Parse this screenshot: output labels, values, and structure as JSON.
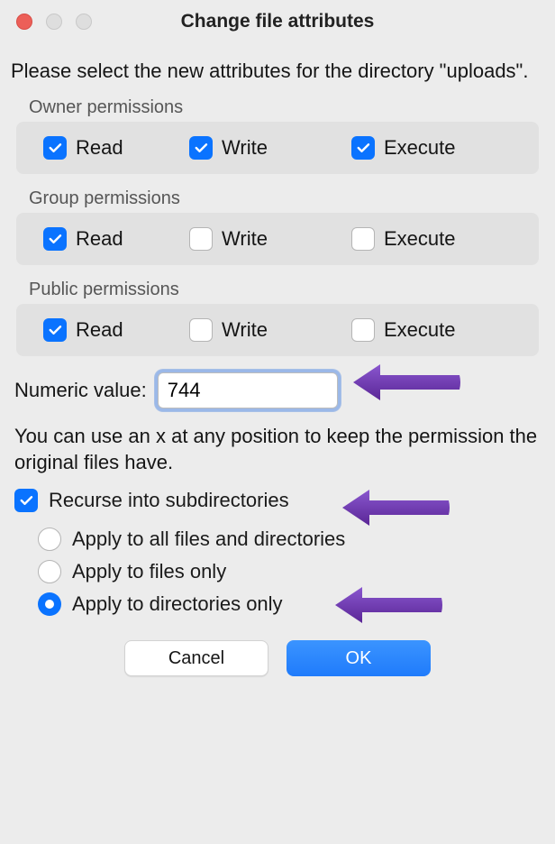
{
  "window": {
    "title": "Change file attributes"
  },
  "intro": "Please select the new attributes for the directory \"uploads\".",
  "permissions": {
    "owner": {
      "label": "Owner permissions",
      "read": {
        "label": "Read",
        "checked": true
      },
      "write": {
        "label": "Write",
        "checked": true
      },
      "execute": {
        "label": "Execute",
        "checked": true
      }
    },
    "group": {
      "label": "Group permissions",
      "read": {
        "label": "Read",
        "checked": true
      },
      "write": {
        "label": "Write",
        "checked": false
      },
      "execute": {
        "label": "Execute",
        "checked": false
      }
    },
    "public": {
      "label": "Public permissions",
      "read": {
        "label": "Read",
        "checked": true
      },
      "write": {
        "label": "Write",
        "checked": false
      },
      "execute": {
        "label": "Execute",
        "checked": false
      }
    }
  },
  "numeric": {
    "label": "Numeric value:",
    "value": "744"
  },
  "help_text": "You can use an x at any position to keep the permission the original files have.",
  "recurse": {
    "label": "Recurse into subdirectories",
    "checked": true
  },
  "apply_options": {
    "all": "Apply to all files and directories",
    "files": "Apply to files only",
    "dirs": "Apply to directories only",
    "selected": "dirs"
  },
  "buttons": {
    "cancel": "Cancel",
    "ok": "OK"
  },
  "annotation_color": "#6b31b0"
}
